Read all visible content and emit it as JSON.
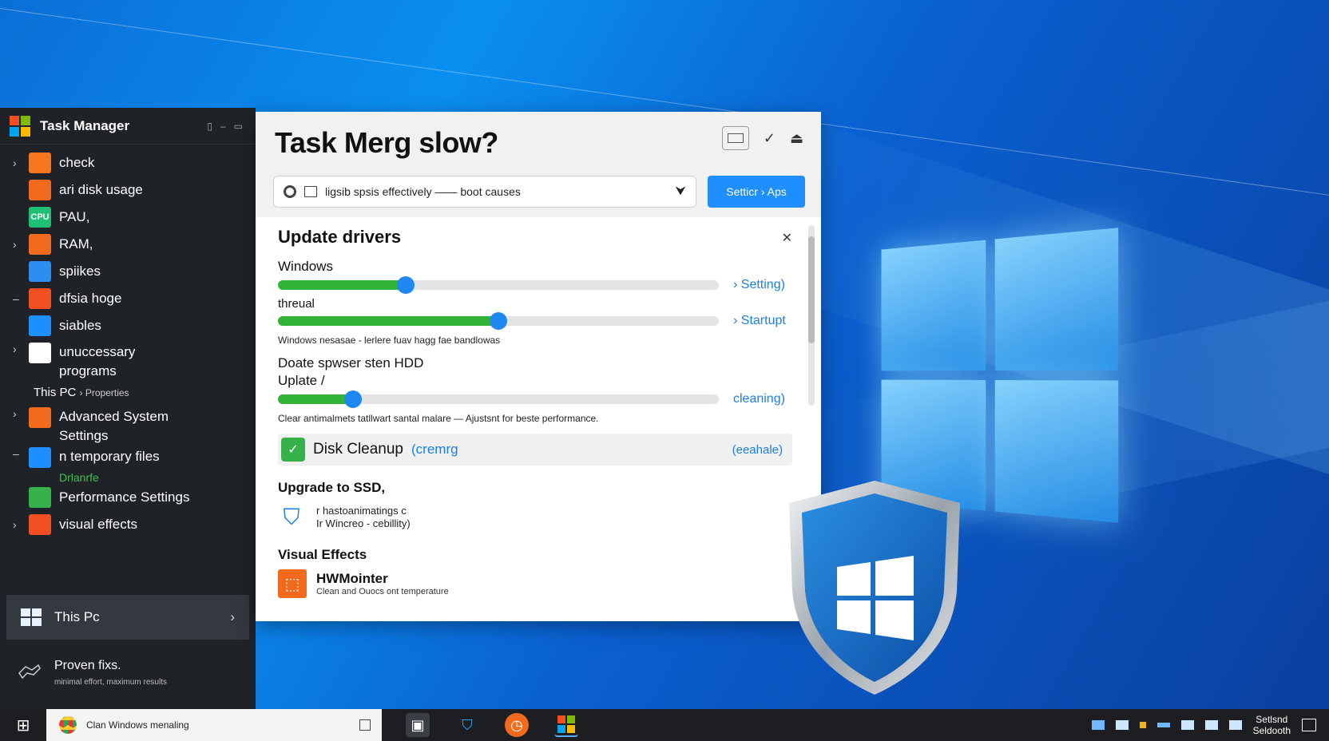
{
  "sidebar": {
    "title": "Task Manager",
    "items": [
      {
        "label": "check",
        "icon": "app-orange-icon",
        "color": "#f4771f",
        "chevron": "›"
      },
      {
        "label": "ari disk usage",
        "icon": "disk-icon",
        "color": "#f26a1b",
        "chevron": ""
      },
      {
        "label": "PAU,",
        "icon": "cpu-icon",
        "icon_text": "CPU",
        "color": "#1fbf74",
        "chevron": ""
      },
      {
        "label": "RAM,",
        "icon": "ring-icon",
        "color": "#f26a1b",
        "chevron": "›"
      },
      {
        "label": "spiikes",
        "icon": "tiles-icon",
        "color": "#2a8ff0",
        "chevron": ""
      },
      {
        "label": "dfsia hoge",
        "icon": "windows-color-icon",
        "color": "#f25022",
        "chevron": "–"
      },
      {
        "label": "siables",
        "icon": "windows-blue-icon",
        "color": "#1f8fff",
        "chevron": ""
      },
      {
        "label": "unuccessary",
        "label2": "programs",
        "icon": "document-icon",
        "color": "#ffffff",
        "chevron": "›"
      }
    ],
    "section": {
      "label": "This PC",
      "sub": "› Properties"
    },
    "items2": [
      {
        "label": "Advanced System",
        "label2": "Settings",
        "icon": "settings-panel-icon",
        "color": "#f26a1b",
        "chevron": "›"
      },
      {
        "label": "n temporary files",
        "sublabel": "Drlanrfe",
        "icon": "files-icon",
        "color": "#1f8fff",
        "chevron": "–"
      },
      {
        "label": "Performance Settings",
        "icon": "performance-icon",
        "color": "#37b14a",
        "chevron": ""
      },
      {
        "label": "visual effects",
        "icon": "windows-color-icon",
        "color": "#f25022",
        "chevron": "›"
      }
    ],
    "this_pc": {
      "label": "This Pc",
      "arrow": "›"
    },
    "footer": {
      "title": "Proven fixs.",
      "sub": "minimal effort, maximum results"
    }
  },
  "window": {
    "title": "Task Merg slow?",
    "search": {
      "value": "ligsib spsis effectively —— boot causes"
    },
    "primary_button": "Setticr › Aps",
    "update_drivers": {
      "heading": "Update drivers",
      "rows": [
        {
          "label": "Windows",
          "value": 0.29,
          "link": "› Setting)"
        },
        {
          "label": "threual",
          "value": 0.5,
          "link": "› Startupt"
        }
      ],
      "note1": "Windows nesasae - lerlere fuav hagg fae bandlowas",
      "row3_label": "Doate spwser sten HDD",
      "row3_label2": "Uplate /",
      "row3": {
        "value": 0.17,
        "link": "cleaning)"
      },
      "note2": "Clear antimalmets tatllwart santal malare — Ajustsnt for beste performance."
    },
    "disk_cleanup": {
      "label": "Disk Cleanup",
      "link": "(cremrg",
      "link2": "(eeahale)"
    },
    "ssd": {
      "heading": "Upgrade to SSD,",
      "line1": "r hastoanimatings c",
      "line2": "Ir Wincreo - cebillity)"
    },
    "visual": {
      "heading": "Visual Effects",
      "app": "HWMointer",
      "app_sub": "Clean and  Ouocs  ont temperature"
    }
  },
  "taskbar": {
    "search_text": "Clan Windows menaling",
    "clock_line1": "Setlsnd",
    "clock_line2": "Seldooth"
  }
}
